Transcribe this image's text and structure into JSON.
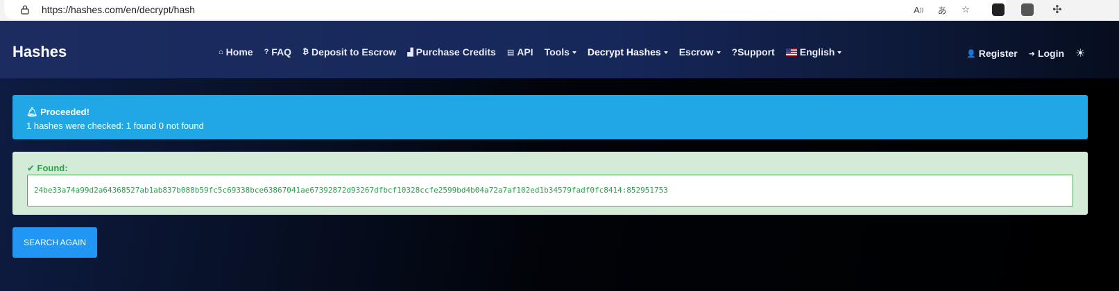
{
  "browser": {
    "url": "https://hashes.com/en/decrypt/hash",
    "icons": [
      "read-aloud-icon",
      "translate-icon",
      "favorite-add-icon",
      "extension-icon-1",
      "extension-icon-2",
      "extensions-puzzle-icon"
    ]
  },
  "navbar": {
    "brand": "Hashes",
    "items": [
      {
        "label": "Home",
        "icon": "home-icon",
        "glyph": "⌂"
      },
      {
        "label": "FAQ",
        "icon": "question-icon",
        "glyph": "?"
      },
      {
        "label": "Deposit to Escrow",
        "icon": "bitcoin-icon",
        "glyph": "₿"
      },
      {
        "label": "Purchase Credits",
        "icon": "cart-icon",
        "glyph": "🛒"
      },
      {
        "label": "API",
        "icon": "server-icon",
        "glyph": "▤"
      },
      {
        "label": "Tools",
        "dropdown": true
      },
      {
        "label": "Decrypt Hashes",
        "dropdown": true,
        "active": true
      },
      {
        "label": "Escrow",
        "dropdown": true
      },
      {
        "label": "?Support"
      },
      {
        "label": "English",
        "icon": "us-flag-icon",
        "dropdown": true
      }
    ],
    "right": {
      "register": "Register",
      "login": "Login"
    }
  },
  "alerts": {
    "info": {
      "title": "Proceeded!",
      "message": "1 hashes were checked: 1 found 0 not found",
      "color": "#22a7e6"
    },
    "success": {
      "title": "Found:",
      "result": "24be33a74a99d2a64368527ab1ab837b088b59fc5c69338bce63867041ae67392872d93267dfbcf10328ccfe2599bd4b04a72a7af102ed1b34579fadf0fc8414:852951753",
      "color": "#27a348"
    }
  },
  "actions": {
    "search_again": "SEARCH AGAIN"
  },
  "colors": {
    "accent": "#2196f3",
    "navbar": "#1c2c60"
  }
}
